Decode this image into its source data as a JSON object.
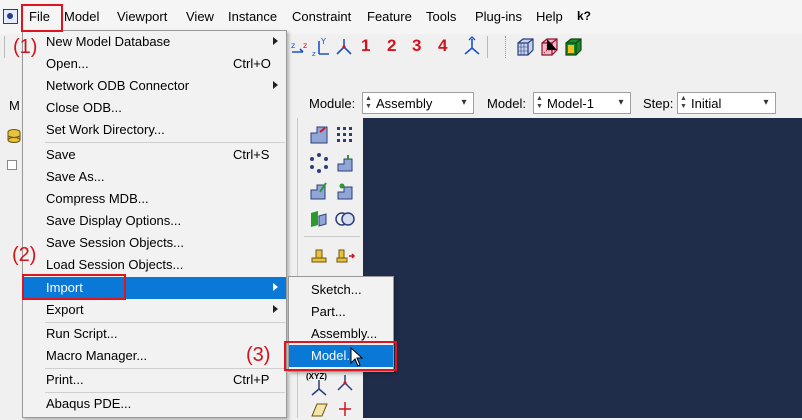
{
  "menubar": {
    "items": [
      "File",
      "Model",
      "Viewport",
      "View",
      "Instance",
      "Constraint",
      "Feature",
      "Tools",
      "Plug-ins",
      "Help",
      "k?"
    ]
  },
  "toolbar": {
    "numbers": [
      "1",
      "2",
      "3",
      "4"
    ]
  },
  "context": {
    "module_label": "Module:",
    "module_value": "Assembly",
    "model_label": "Model:",
    "model_value": "Model-1",
    "step_label": "Step:",
    "step_value": "Initial"
  },
  "left_panel": {
    "tab_letter": "M"
  },
  "file_menu": {
    "items": [
      {
        "label": "New Model Database",
        "shortcut": "",
        "submenu": true
      },
      {
        "label": "Open...",
        "shortcut": "Ctrl+O",
        "submenu": false
      },
      {
        "label": "Network ODB Connector",
        "shortcut": "",
        "submenu": true
      },
      {
        "label": "Close ODB...",
        "shortcut": "",
        "submenu": false
      },
      {
        "label": "Set Work Directory...",
        "shortcut": "",
        "submenu": false
      },
      {
        "label": "Save",
        "shortcut": "Ctrl+S",
        "submenu": false
      },
      {
        "label": "Save As...",
        "shortcut": "",
        "submenu": false
      },
      {
        "label": "Compress MDB...",
        "shortcut": "",
        "submenu": false
      },
      {
        "label": "Save Display Options...",
        "shortcut": "",
        "submenu": false
      },
      {
        "label": "Save Session Objects...",
        "shortcut": "",
        "submenu": false
      },
      {
        "label": "Load Session Objects...",
        "shortcut": "",
        "submenu": false
      },
      {
        "label": "Import",
        "shortcut": "",
        "submenu": true
      },
      {
        "label": "Export",
        "shortcut": "",
        "submenu": true
      },
      {
        "label": "Run Script...",
        "shortcut": "",
        "submenu": false
      },
      {
        "label": "Macro Manager...",
        "shortcut": "",
        "submenu": false
      },
      {
        "label": "Print...",
        "shortcut": "Ctrl+P",
        "submenu": false
      },
      {
        "label": "Abaqus PDE...",
        "shortcut": "",
        "submenu": false
      }
    ],
    "highlighted": "Import"
  },
  "import_submenu": {
    "items": [
      "Sketch...",
      "Part...",
      "Assembly...",
      "Model..."
    ],
    "highlighted": "Model..."
  },
  "annotations": [
    "(1)",
    "(2)",
    "(3)"
  ],
  "tool_labels": {
    "xyz": "(XYZ)"
  },
  "colors": {
    "highlight": "#0a78d7",
    "annotation": "#e0141e",
    "viewport": "#1f2d4b"
  }
}
